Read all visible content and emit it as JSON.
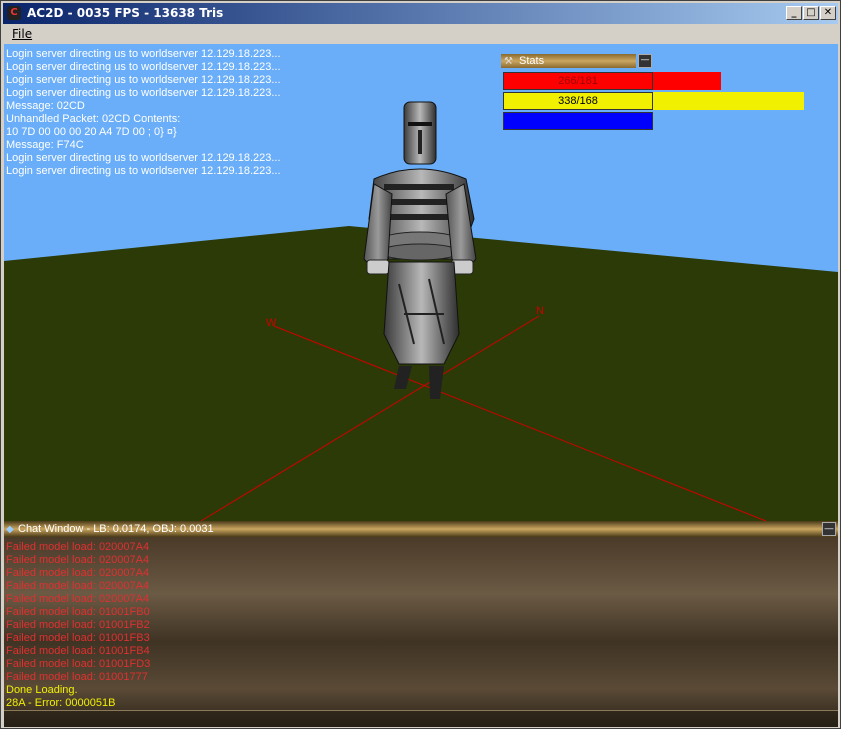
{
  "window": {
    "title": "AC2D - 0035 FPS - 13638 Tris",
    "app_icon": "app-icon",
    "controls": [
      "minimize-icon",
      "maximize-icon",
      "close-icon"
    ]
  },
  "menu": {
    "file_label": "File"
  },
  "log": {
    "lines": [
      "Login server directing us to worldserver 12.129.18.223...",
      "Login server directing us to worldserver 12.129.18.223...",
      "Login server directing us to worldserver 12.129.18.223...",
      "Login server directing us to worldserver 12.129.18.223...",
      "Message: 02CD",
      "Unhandled Packet: 02CD Contents:",
      "10 7D 00 00 00 20 A4 7D 00 ; 0} ¤}",
      "Message: F74C",
      "Login server directing us to worldserver 12.129.18.223...",
      "Login server directing us to worldserver 12.129.18.223..."
    ]
  },
  "stats": {
    "title": "Stats",
    "health": {
      "text": "266/181",
      "color": "#ff0000",
      "current": 266,
      "max": 181
    },
    "stamina": {
      "text": "338/168",
      "color": "#f0f000",
      "current": 338,
      "max": 168
    },
    "mana": {
      "text": "",
      "color": "#0000ff"
    }
  },
  "compass": {
    "west": "W",
    "north": "N"
  },
  "chat": {
    "title": "Chat Window - LB: 0.0174, OBJ: 0.0031",
    "lines": [
      {
        "text": "Failed model load: 020007A4",
        "color": "#e03030"
      },
      {
        "text": "Failed model load: 020007A4",
        "color": "#e03030"
      },
      {
        "text": "Failed model load: 020007A4",
        "color": "#e03030"
      },
      {
        "text": "Failed model load: 020007A4",
        "color": "#e03030"
      },
      {
        "text": "Failed model load: 020007A4",
        "color": "#e03030"
      },
      {
        "text": "Failed model load: 01001FB0",
        "color": "#e03030"
      },
      {
        "text": "Failed model load: 01001FB2",
        "color": "#e03030"
      },
      {
        "text": "Failed model load: 01001FB3",
        "color": "#e03030"
      },
      {
        "text": "Failed model load: 01001FB4",
        "color": "#e03030"
      },
      {
        "text": "Failed model load: 01001FD3",
        "color": "#e03030"
      },
      {
        "text": "Failed model load: 01001777",
        "color": "#e03030"
      },
      {
        "text": "Done Loading.",
        "color": "#f0f000"
      },
      {
        "text": "28A - Error: 0000051B",
        "color": "#f0f000"
      }
    ]
  },
  "colors": {
    "sky": "#6aaef9",
    "ground": "#2b3a06",
    "compass_line": "#d00000"
  }
}
